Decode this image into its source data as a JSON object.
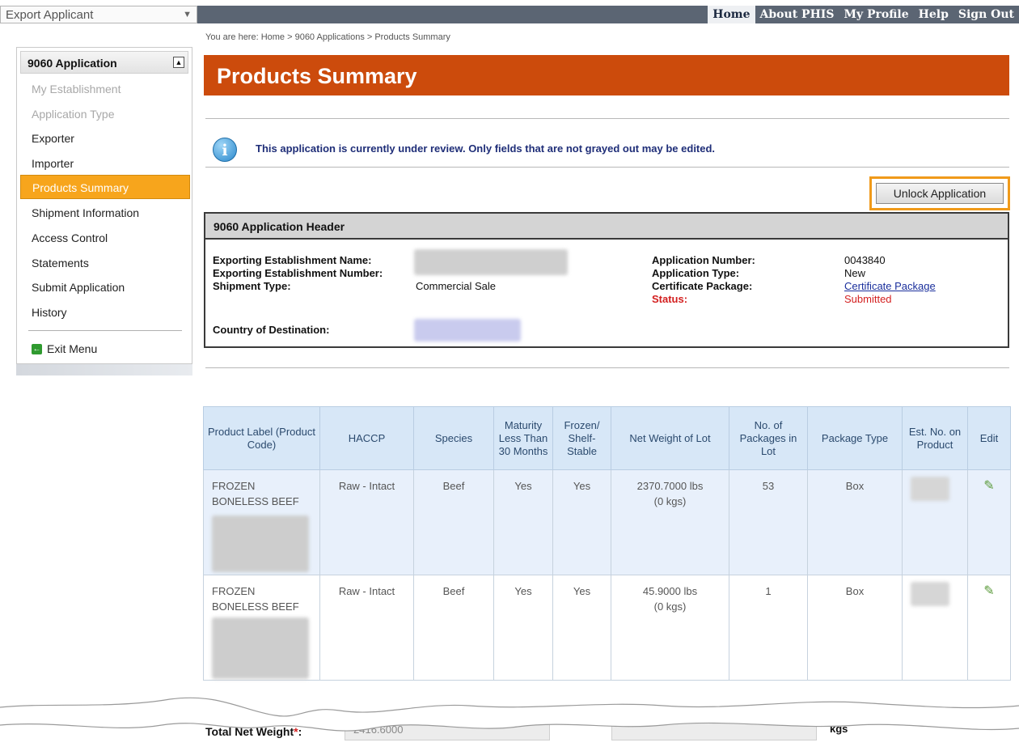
{
  "topbar": {
    "role": "Export Applicant",
    "nav": [
      "Home",
      "About PHIS",
      "My Profile",
      "Help",
      "Sign Out"
    ]
  },
  "breadcrumb": "You are here: Home > 9060 Applications > Products Summary",
  "sidebar": {
    "title": "9060 Application",
    "items": [
      {
        "label": "My Establishment",
        "state": "disabled"
      },
      {
        "label": "Application Type",
        "state": "disabled"
      },
      {
        "label": "Exporter",
        "state": "normal"
      },
      {
        "label": "Importer",
        "state": "normal"
      },
      {
        "label": "Products Summary",
        "state": "active"
      },
      {
        "label": "Shipment Information",
        "state": "normal"
      },
      {
        "label": "Access Control",
        "state": "normal"
      },
      {
        "label": "Statements",
        "state": "normal"
      },
      {
        "label": "Submit Application",
        "state": "normal"
      },
      {
        "label": "History",
        "state": "normal"
      }
    ],
    "exit": "Exit Menu"
  },
  "page_title": "Products Summary",
  "info_message": "This application is currently under review. Only fields that are not grayed out may be edited.",
  "unlock_button": "Unlock Application",
  "header": {
    "title": "9060 Application Header",
    "exporting_establishment_name_label": "Exporting Establishment Name:",
    "exporting_establishment_number_label": "Exporting Establishment Number:",
    "shipment_type_label": "Shipment Type:",
    "shipment_type": "Commercial Sale",
    "country_label": "Country of Destination:",
    "application_number_label": "Application Number:",
    "application_number": "0043840",
    "application_type_label": "Application Type:",
    "application_type": "New",
    "certificate_package_label": "Certificate Package:",
    "certificate_package": "Certificate Package",
    "status_label": "Status:",
    "status": "Submitted"
  },
  "table": {
    "columns": [
      "Product Label (Product Code)",
      "HACCP",
      "Species",
      "Maturity Less Than 30 Months",
      "Frozen/ Shelf-Stable",
      "Net Weight of Lot",
      "No. of Packages in Lot",
      "Package Type",
      "Est. No. on Product",
      "Edit"
    ],
    "rows": [
      {
        "label": "FROZEN BONELESS BEEF",
        "haccp": "Raw - Intact",
        "species": "Beef",
        "maturity": "Yes",
        "frozen": "Yes",
        "net_weight": "2370.7000 lbs",
        "net_weight_kgs": "(0 kgs)",
        "packages": "53",
        "package_type": "Box"
      },
      {
        "label": "FROZEN BONELESS BEEF",
        "haccp": "Raw - Intact",
        "species": "Beef",
        "maturity": "Yes",
        "frozen": "Yes",
        "net_weight": "45.9000 lbs",
        "net_weight_kgs": "(0 kgs)",
        "packages": "1",
        "package_type": "Box"
      }
    ]
  },
  "total": {
    "label": "Total Net Weight",
    "value": "2416.6000",
    "unit_kgs": "kgs"
  },
  "colors": {
    "banner": "#cc4b0c",
    "active_nav": "#f7a51c",
    "status_red": "#d31f1f",
    "table_header": "#d7e7f7"
  }
}
